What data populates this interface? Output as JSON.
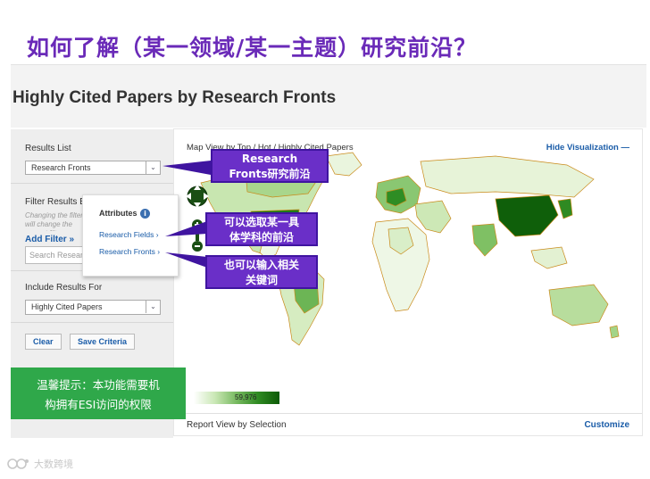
{
  "slide": {
    "title": "如何了解（某一领域/某一主题）研究前沿？"
  },
  "page": {
    "heading": "Highly Cited Papers by Research Fronts"
  },
  "sidebar": {
    "results_list_label": "Results List",
    "results_list_value": "Research Fronts",
    "filter_results_label": "Filter Results By",
    "filter_hint": "Changing the filters will change the current filters.",
    "add_filter_label": "Add Filter »",
    "search_placeholder": "Search Research...",
    "include_results_label": "Include Results For",
    "include_results_value": "Highly Cited Papers",
    "clear_label": "Clear",
    "save_criteria_label": "Save Criteria"
  },
  "popup": {
    "heading": "Attributes",
    "info_icon": "i",
    "options": [
      "Research Fields ›",
      "Research Fronts ›"
    ]
  },
  "map": {
    "title": "Map View by Top / Hot / Highly Cited Papers",
    "hide_label": "Hide Visualization",
    "legend_min": "0",
    "legend_max": "59,976",
    "report_view_label": "Report View by Selection",
    "customize_label": "Customize"
  },
  "callouts": {
    "research_fronts": [
      "Research",
      "Fronts研究前沿"
    ],
    "select_field": [
      "可以选取某一具",
      "体学科的前沿"
    ],
    "keywords": [
      "也可以输入相关",
      "关键词"
    ]
  },
  "note": {
    "lines": [
      "温馨提示：本功能需要机",
      "构拥有ESI访问的权限"
    ]
  },
  "logo": {
    "text": "大数跨境"
  },
  "colors": {
    "title_purple": "#6a2ab8",
    "callout_purple": "#6a2fc8",
    "note_green": "#2fa84a",
    "link_blue": "#1a5ca8",
    "map_dark_green": "#0d5a07"
  }
}
